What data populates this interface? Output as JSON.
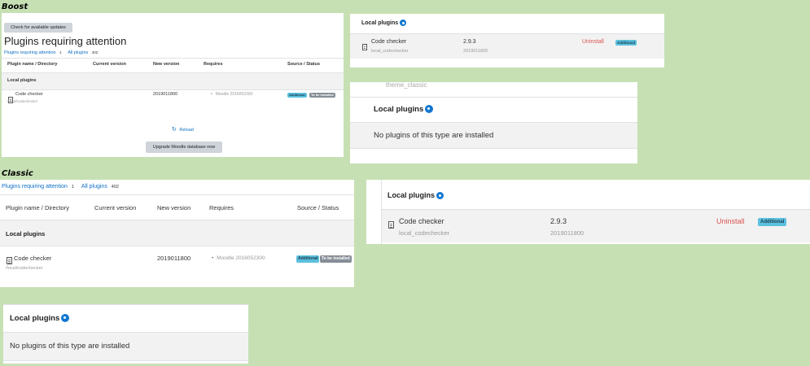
{
  "labels": {
    "boost": "Boost",
    "classic": "Classic"
  },
  "boost": {
    "check_button": "Check for available updates",
    "title": "Plugins requiring attention",
    "filter_attention": "Plugins requiring attention",
    "filter_attention_count": "1",
    "filter_all": "All plugins",
    "filter_all_count": "402",
    "columns": [
      "Plugin name / Directory",
      "Current version",
      "New version",
      "Requires",
      "Source / Status"
    ],
    "group_row": "Local plugins",
    "plugin": {
      "name": "Code checker",
      "dir": "/local/codechecker",
      "new_version": "2019011800",
      "requires": "Moodle 2016052300",
      "badge_additional": "Additional",
      "badge_status": "To be installed"
    },
    "reload": "Reload",
    "upgrade_button": "Upgrade Moodle database now"
  },
  "boost_local_installed": {
    "title": "Local plugins",
    "name": "Code checker",
    "component": "local_codechecker",
    "version": "2.9.3",
    "version_num": "2019011800",
    "uninstall": "Uninstall",
    "badge": "Additional"
  },
  "boost_local_empty": {
    "prev_row": "theme_classic",
    "title": "Local plugins",
    "empty": "No plugins of this type are installed"
  },
  "classic": {
    "filter_attention": "Plugins requiring attention",
    "filter_attention_count": "1",
    "filter_all": "All plugins",
    "filter_all_count": "402",
    "columns": [
      "Plugin name / Directory",
      "Current version",
      "New version",
      "Requires",
      "Source / Status"
    ],
    "group_row": "Local plugins",
    "plugin": {
      "name": "Code checker",
      "dir": "/local/codechecker",
      "new_version": "2019011800",
      "requires": "Moodle 2016052300",
      "badge_additional": "Additional",
      "badge_status": "To be installed"
    }
  },
  "classic_local_installed": {
    "title": "Local plugins",
    "name": "Code checker",
    "component": "local_codechecker",
    "version": "2.9.3",
    "version_num": "2019011800",
    "uninstall": "Uninstall",
    "badge": "Additional"
  },
  "classic_local_empty": {
    "title": "Local plugins",
    "empty": "No plugins of this type are installed"
  },
  "colors": {
    "background": "#c6e0b4",
    "link": "#0f6fc5",
    "uninstall": "#d9534f",
    "badge_info": "#5bc0de",
    "badge_secondary": "#868e96"
  }
}
